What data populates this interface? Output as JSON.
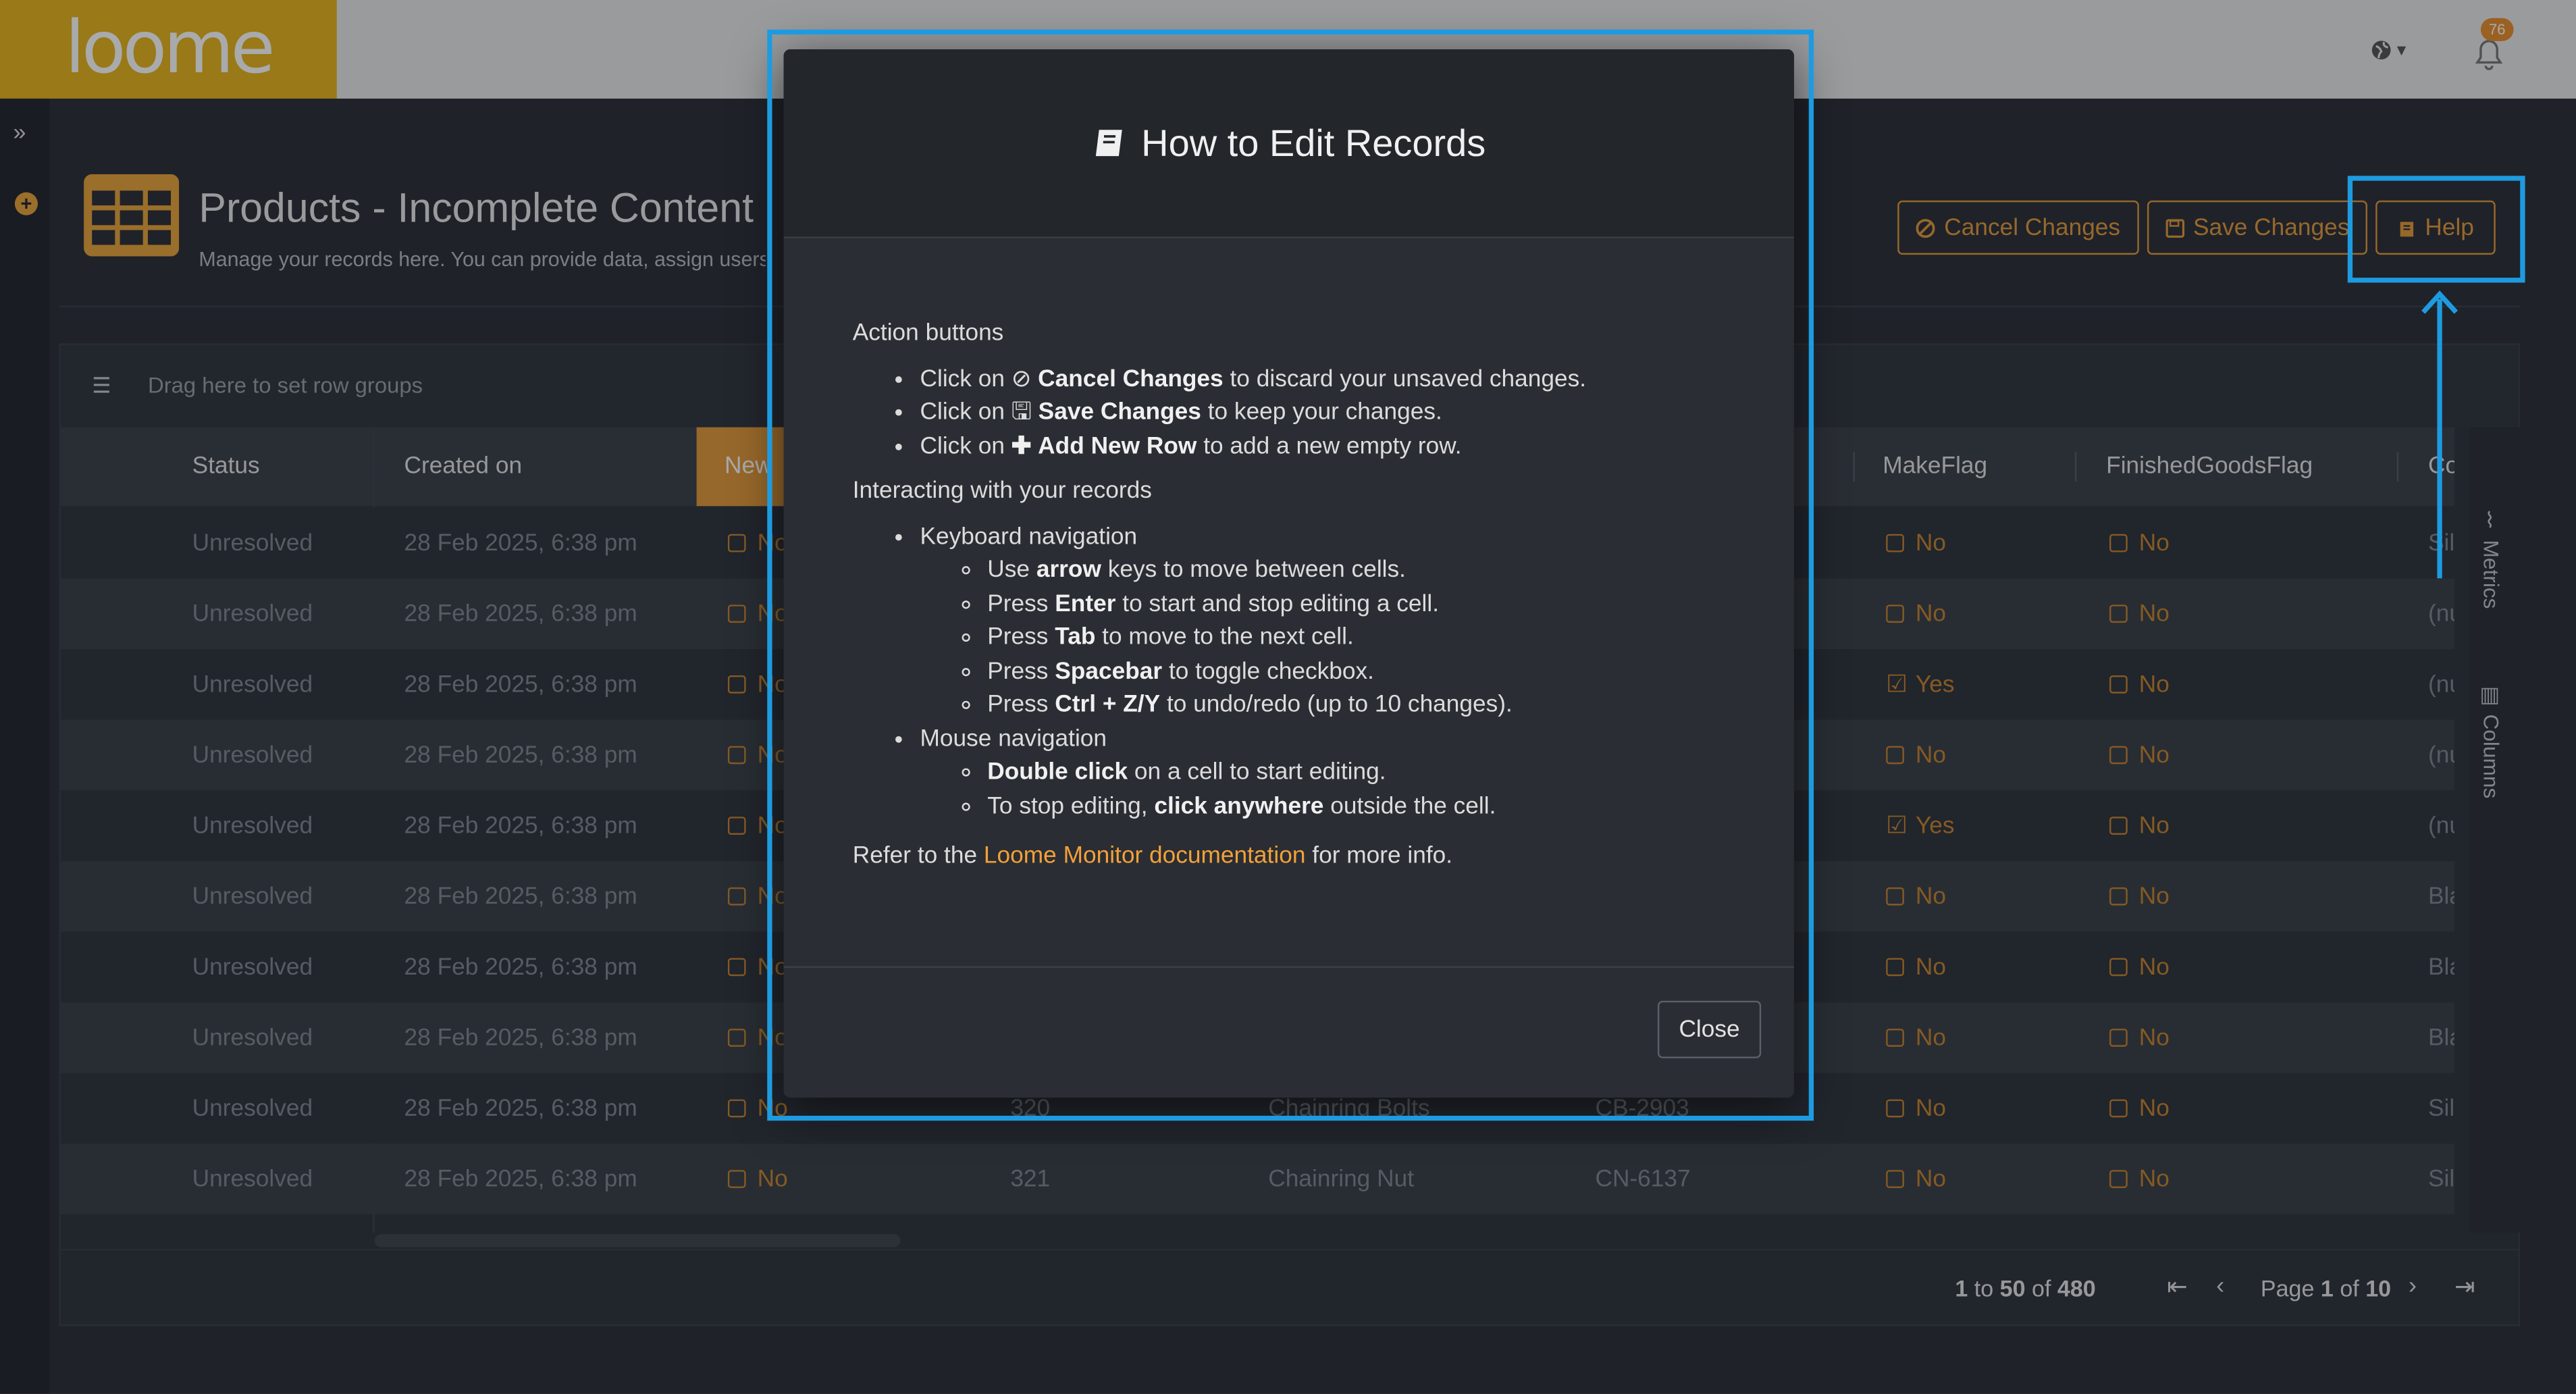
{
  "app": {
    "logo_text": "loome"
  },
  "topbar": {
    "notification_count": "76",
    "globe_caret": "▾"
  },
  "page": {
    "title": "Products - Incomplete Content",
    "subtitle": "Manage your records here. You can provide data, assign users, pr"
  },
  "toolbar": {
    "cancel_label": "Cancel Changes",
    "save_label": "Save Changes",
    "help_label": "Help"
  },
  "grid": {
    "group_placeholder": "Drag here to set row groups",
    "columns": [
      "Status",
      "Created on",
      "New",
      "MakeFlag",
      "FinishedGoodsFlag",
      "Colo"
    ],
    "rows": [
      {
        "status": "Unresolved",
        "created": "28 Feb 2025, 6:38 pm",
        "new": "No",
        "make": "No",
        "finished": "No",
        "color": "Sil"
      },
      {
        "status": "Unresolved",
        "created": "28 Feb 2025, 6:38 pm",
        "new": "No",
        "make": "No",
        "finished": "No",
        "color": "(nu"
      },
      {
        "status": "Unresolved",
        "created": "28 Feb 2025, 6:38 pm",
        "new": "No",
        "make": "Yes",
        "finished": "No",
        "color": "(nu"
      },
      {
        "status": "Unresolved",
        "created": "28 Feb 2025, 6:38 pm",
        "new": "No",
        "make": "No",
        "finished": "No",
        "color": "(nu"
      },
      {
        "status": "Unresolved",
        "created": "28 Feb 2025, 6:38 pm",
        "new": "No",
        "make": "Yes",
        "finished": "No",
        "color": "(nu"
      },
      {
        "status": "Unresolved",
        "created": "28 Feb 2025, 6:38 pm",
        "new": "No",
        "make": "No",
        "finished": "No",
        "color": "Bla"
      },
      {
        "status": "Unresolved",
        "created": "28 Feb 2025, 6:38 pm",
        "new": "No",
        "make": "No",
        "finished": "No",
        "color": "Bla"
      },
      {
        "status": "Unresolved",
        "created": "28 Feb 2025, 6:38 pm",
        "new": "No",
        "make": "No",
        "finished": "No",
        "color": "Bla"
      },
      {
        "status": "Unresolved",
        "created": "28 Feb 2025, 6:38 pm",
        "new": "No",
        "id": "320",
        "name": "Chainring Bolts",
        "number": "CB-2903",
        "make": "No",
        "finished": "No",
        "color": "Sil"
      },
      {
        "status": "Unresolved",
        "created": "28 Feb 2025, 6:38 pm",
        "new": "No",
        "id": "321",
        "name": "Chainring Nut",
        "number": "CN-6137",
        "make": "No",
        "finished": "No",
        "color": "Sil"
      }
    ]
  },
  "pager": {
    "range_from": "1",
    "range_to_label": "to",
    "range_to": "50",
    "of_label": "of",
    "total": "480",
    "page_label": "Page",
    "page": "1",
    "page_of_label": "of",
    "page_count": "10"
  },
  "side_tabs": {
    "metrics": "Metrics",
    "columns": "Columns"
  },
  "modal": {
    "title": "How to Edit Records",
    "section1": "Action buttons",
    "a1_pre": "Click on",
    "a1_bold": "Cancel Changes",
    "a1_post": "to discard your unsaved changes.",
    "a2_pre": "Click on",
    "a2_bold": "Save Changes",
    "a2_post": "to keep your changes.",
    "a3_pre": "Click on",
    "a3_bold": "Add New Row",
    "a3_post": "to add a new empty row.",
    "section2": "Interacting with your records",
    "kb_title": "Keyboard navigation",
    "k1_pre": "Use",
    "k1_bold": "arrow",
    "k1_post": "keys to move between cells.",
    "k2_pre": "Press",
    "k2_bold": "Enter",
    "k2_post": "to start and stop editing a cell.",
    "k3_pre": "Press",
    "k3_bold": "Tab",
    "k3_post": "to move to the next cell.",
    "k4_pre": "Press",
    "k4_bold": "Spacebar",
    "k4_post": "to toggle checkbox.",
    "k5_pre": "Press",
    "k5_bold": "Ctrl + Z/Y",
    "k5_post": "to undo/redo (up to 10 changes).",
    "mouse_title": "Mouse navigation",
    "m1_bold": "Double click",
    "m1_post": "on a cell to start editing.",
    "m2_pre": "To stop editing,",
    "m2_bold": "click anywhere",
    "m2_post": "outside the cell.",
    "ref_pre": "Refer to the",
    "ref_link": "Loome Monitor documentation",
    "ref_post": "for more info.",
    "close_label": "Close"
  },
  "colors": {
    "brand": "#e7b41c",
    "accent": "#e39a39",
    "highlight": "#1e9be0"
  }
}
